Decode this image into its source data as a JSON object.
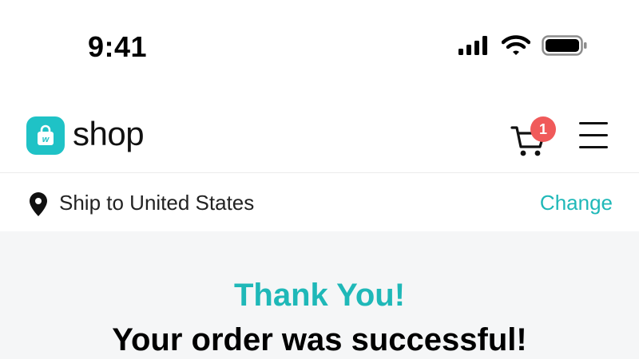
{
  "status_bar": {
    "time": "9:41",
    "icons": [
      "signal-icon",
      "wifi-icon",
      "battery-icon"
    ]
  },
  "header": {
    "logo_text": "shop",
    "logo_letter": "w",
    "cart_count": "1",
    "icons": [
      "shopping-bag-icon",
      "cart-icon",
      "menu-icon"
    ]
  },
  "ship": {
    "label": "Ship to United States",
    "change_label": "Change",
    "icon": "location-pin-icon"
  },
  "main": {
    "thanks": "Thank You!",
    "message": "Your order was successful!"
  },
  "colors": {
    "accent": "#1fc2c6",
    "accent_text": "#1fb8b8",
    "badge": "#f05a5a",
    "main_bg": "#f5f6f7"
  }
}
